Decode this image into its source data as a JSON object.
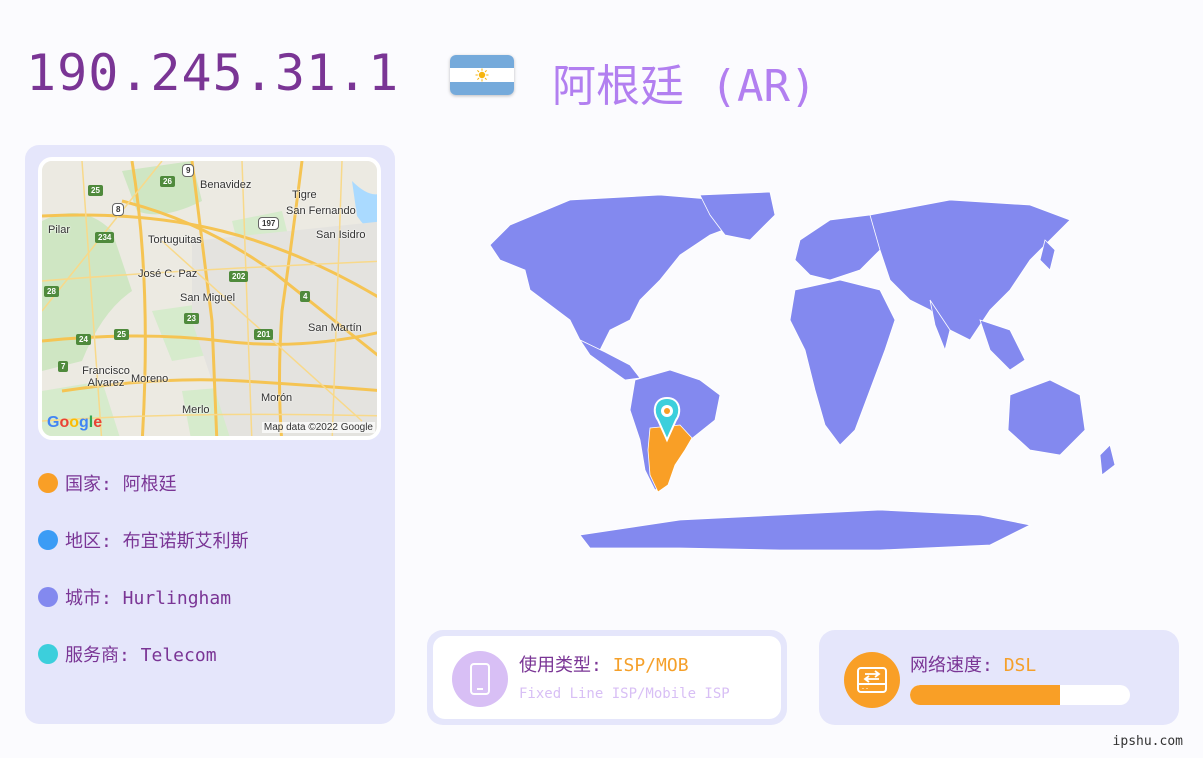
{
  "header": {
    "ip": "190.245.31.1",
    "country_title": "阿根廷 (AR)",
    "flag_icon": "argentina-flag-icon",
    "flag_colors": [
      "#75aadb",
      "#ffffff",
      "#75aadb"
    ]
  },
  "minimap": {
    "labels": [
      "Benavidez",
      "Tigre",
      "San Fernando",
      "Pilar",
      "Tortuguitas",
      "San Isidro",
      "José C. Paz",
      "San Miguel",
      "San Martín",
      "Francisco Alvarez",
      "Moreno",
      "Merlo",
      "Morón"
    ],
    "shields": [
      "9",
      "26",
      "25",
      "8",
      "197",
      "234",
      "202",
      "28",
      "4",
      "23",
      "24",
      "25",
      "201",
      "7"
    ],
    "logo": "Google",
    "credit": "Map data ©2022 Google"
  },
  "info": [
    {
      "label": "国家: 阿根廷",
      "color": "#f99f26"
    },
    {
      "label": "地区: 布宜诺斯艾利斯",
      "color": "#3b9cf5"
    },
    {
      "label": "城市: Hurlingham",
      "color": "#8389ef"
    },
    {
      "label": "服务商: Telecom",
      "color": "#3ccfdc"
    }
  ],
  "usage": {
    "label": "使用类型: ",
    "value": "ISP/MOB",
    "sub": "Fixed Line ISP/Mobile ISP",
    "icon": "mobile-phone-icon"
  },
  "speed": {
    "label": "网络速度: ",
    "value": "DSL",
    "level": 0.68,
    "icon": "network-transfer-icon"
  },
  "colors": {
    "land": "#8389ef",
    "highlight": "#f99f26",
    "pin": "#3ccfdc",
    "title": "#7a3595"
  },
  "footer": "ipshu.com"
}
